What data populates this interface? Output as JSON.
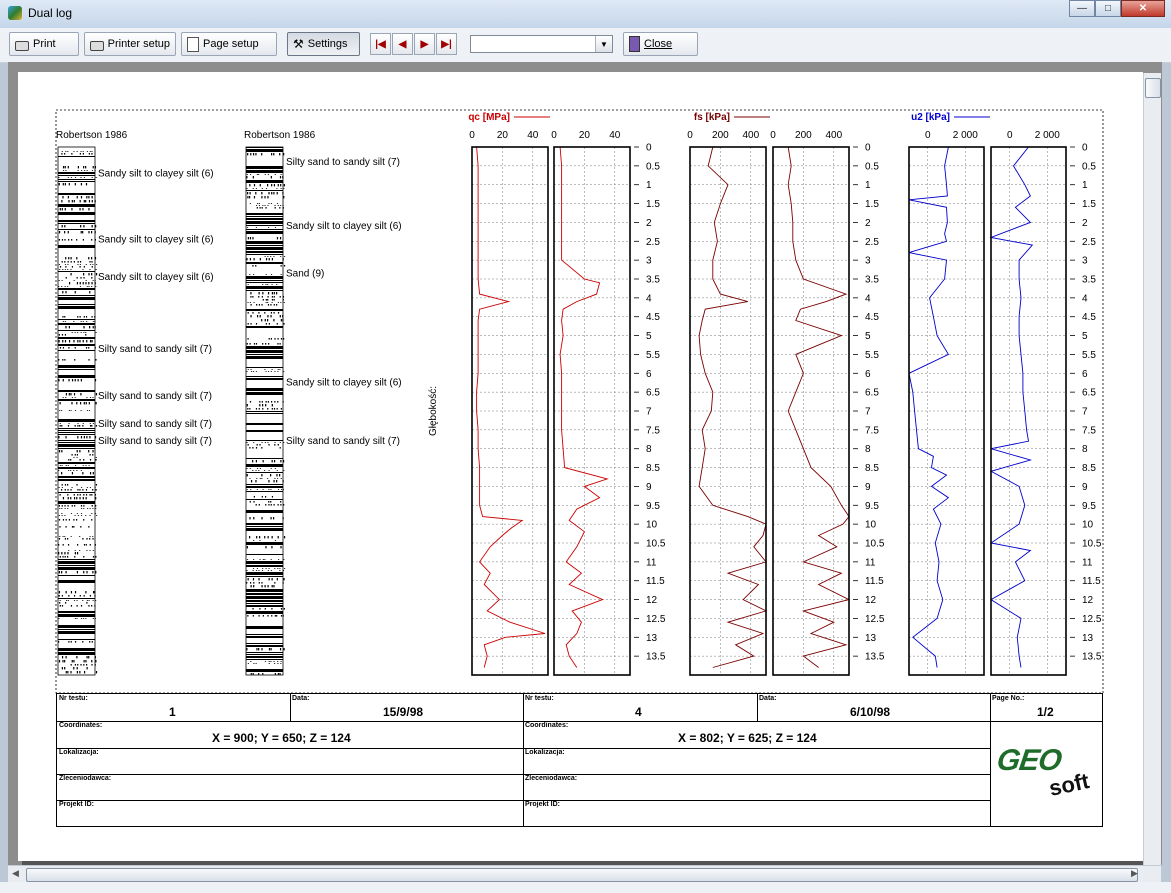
{
  "window": {
    "title": "Dual log"
  },
  "toolbar": {
    "print_label": "Print",
    "printer_setup_label": "Printer setup",
    "page_setup_label": "Page setup",
    "settings_label": "Settings",
    "close_label": "Close",
    "combo_value": "",
    "nav": {
      "first": "|◀",
      "prev": "◀",
      "next": "▶",
      "last": "▶|"
    }
  },
  "columns": {
    "left": {
      "title": "Robertson 1986",
      "labels": [
        {
          "depth": 0.7,
          "text": "Sandy silt to clayey silt (6)"
        },
        {
          "depth": 2.45,
          "text": "Sandy silt to clayey silt (6)"
        },
        {
          "depth": 3.45,
          "text": "Sandy silt to clayey silt (6)"
        },
        {
          "depth": 5.35,
          "text": "Silty sand to sandy silt (7)"
        },
        {
          "depth": 6.6,
          "text": "Silty sand to sandy silt (7)"
        },
        {
          "depth": 7.35,
          "text": "Silty sand to sandy silt (7)"
        },
        {
          "depth": 7.8,
          "text": "Silty sand to sandy silt (7)"
        }
      ]
    },
    "right": {
      "title": "Robertson 1986",
      "labels": [
        {
          "depth": 0.4,
          "text": "Silty sand to sandy silt (7)"
        },
        {
          "depth": 2.1,
          "text": "Sandy silt to clayey silt (6)"
        },
        {
          "depth": 3.35,
          "text": "Sand (9)"
        },
        {
          "depth": 6.25,
          "text": "Sandy silt to clayey silt (6)"
        },
        {
          "depth": 7.8,
          "text": "Silty sand to sandy silt (7)"
        }
      ]
    }
  },
  "chart_data": {
    "type": "line",
    "ylabel": "Głębokość:",
    "ylim": [
      0,
      14
    ],
    "y_ticks": [
      "0",
      "0.5",
      "1",
      "1.5",
      "2",
      "2.5",
      "3",
      "3.5",
      "4",
      "4.5",
      "5",
      "5.5",
      "6",
      "6.5",
      "7",
      "7.5",
      "8",
      "8.5",
      "9",
      "9.5",
      "10",
      "10.5",
      "11",
      "11.5",
      "12",
      "12.5",
      "13",
      "13.5"
    ],
    "grid": true,
    "panels": [
      {
        "name": "qc [MPa]",
        "color": "#cc0000",
        "xlim": [
          0,
          50
        ],
        "ticks": [
          "0",
          "20",
          "40"
        ],
        "series": [
          {
            "depth": [
              0,
              0.5,
              1,
              1.5,
              2,
              2.5,
              3,
              3.5,
              3.9,
              4.1,
              4.3,
              4.6,
              5,
              5.5,
              6,
              6.5,
              7,
              7.5,
              8,
              8.5,
              9,
              9.5,
              9.8,
              9.9,
              10.1,
              10.3,
              10.6,
              11,
              11.3,
              11.6,
              12,
              12.3,
              12.6,
              12.9,
              13.0,
              13.2,
              13.5,
              13.8
            ],
            "value": [
              3,
              4,
              4,
              4,
              4,
              4,
              4,
              4,
              5,
              24,
              5,
              4,
              4,
              4,
              4,
              3,
              3,
              4,
              4,
              5,
              5,
              5,
              7,
              33,
              26,
              20,
              12,
              5,
              12,
              8,
              18,
              10,
              25,
              48,
              22,
              8,
              10,
              8
            ]
          },
          {
            "depth": [
              0,
              0.5,
              1,
              1.5,
              2,
              2.5,
              3,
              3.5,
              3.6,
              3.9,
              4.1,
              4.3,
              4.6,
              5,
              5.5,
              6,
              6.5,
              7,
              7.5,
              8,
              8.5,
              8.8,
              9,
              9.3,
              9.6,
              9.9,
              10.2,
              10.6,
              11,
              11.3,
              11.6,
              12,
              12.3,
              12.6,
              12.9,
              13.2,
              13.5,
              13.8
            ],
            "value": [
              4,
              5,
              5,
              5,
              5,
              5,
              5,
              20,
              30,
              28,
              15,
              6,
              5,
              6,
              4,
              5,
              5,
              5,
              5,
              6,
              7,
              35,
              20,
              30,
              15,
              10,
              20,
              15,
              8,
              18,
              10,
              32,
              12,
              18,
              15,
              8,
              10,
              15
            ]
          }
        ]
      },
      {
        "name": "fs [kPa]",
        "color": "#7a0000",
        "xlim": [
          0,
          500
        ],
        "ticks": [
          "0",
          "200",
          "400"
        ],
        "series": [
          {
            "depth": [
              0,
              0.5,
              1,
              1.5,
              2,
              2.5,
              3,
              3.5,
              3.9,
              4.1,
              4.3,
              4.6,
              5,
              5.5,
              6,
              6.5,
              7,
              7.5,
              8,
              8.5,
              9,
              9.5,
              9.8,
              10,
              10.3,
              10.6,
              11,
              11.3,
              11.6,
              12,
              12.3,
              12.6,
              12.9,
              13.2,
              13.5,
              13.8
            ],
            "value": [
              150,
              120,
              250,
              200,
              160,
              180,
              150,
              150,
              200,
              380,
              100,
              80,
              60,
              70,
              100,
              150,
              140,
              80,
              100,
              80,
              60,
              150,
              380,
              500,
              480,
              420,
              500,
              250,
              450,
              350,
              500,
              250,
              480,
              300,
              420,
              150
            ]
          },
          {
            "depth": [
              0,
              0.5,
              1,
              1.5,
              2,
              2.5,
              3,
              3.5,
              3.9,
              4.1,
              4.3,
              4.6,
              5,
              5.5,
              6,
              6.5,
              7,
              7.5,
              8,
              8.5,
              9,
              9.5,
              9.8,
              10,
              10.3,
              10.6,
              11,
              11.3,
              11.6,
              12,
              12.3,
              12.6,
              12.9,
              13.2,
              13.5,
              13.8
            ],
            "value": [
              100,
              120,
              100,
              120,
              130,
              130,
              150,
              200,
              480,
              350,
              180,
              150,
              450,
              150,
              200,
              150,
              100,
              150,
              200,
              250,
              380,
              450,
              500,
              460,
              300,
              420,
              200,
              450,
              300,
              500,
              200,
              400,
              250,
              480,
              200,
              300
            ]
          }
        ]
      },
      {
        "name": "u2 [kPa]",
        "color": "#0000cc",
        "xlim": [
          -1000,
          3000
        ],
        "ticks": [
          "0",
          "2 000"
        ],
        "series": [
          {
            "depth": [
              0,
              0.5,
              1,
              1.3,
              1.4,
              1.6,
              2,
              2.3,
              2.5,
              2.8,
              3,
              3.5,
              4,
              4.5,
              5,
              5.5,
              6,
              6.5,
              7,
              7.5,
              8,
              8.2,
              8.5,
              8.7,
              9,
              9.3,
              9.6,
              10,
              10.5,
              11,
              11.5,
              12,
              12.5,
              13,
              13.5,
              13.8
            ],
            "value": [
              1100,
              900,
              1000,
              1050,
              -1000,
              1000,
              1050,
              900,
              1000,
              -1000,
              1000,
              900,
              100,
              300,
              500,
              1100,
              -1000,
              -800,
              -700,
              -600,
              -500,
              300,
              200,
              1000,
              200,
              1100,
              300,
              700,
              400,
              600,
              500,
              800,
              500,
              -800,
              400,
              500
            ]
          },
          {
            "depth": [
              0,
              0.5,
              1,
              1.3,
              1.6,
              2,
              2.4,
              2.6,
              3,
              3.5,
              4,
              4.5,
              5,
              5.5,
              6,
              6.5,
              7,
              7.5,
              7.8,
              8.0,
              8.3,
              8.6,
              9,
              9.5,
              10,
              10.5,
              10.7,
              11,
              11.5,
              12,
              12.5,
              13,
              13.5,
              13.8
            ],
            "value": [
              1000,
              200,
              800,
              1100,
              300,
              1100,
              -1000,
              1200,
              500,
              500,
              600,
              500,
              500,
              600,
              700,
              700,
              800,
              900,
              1000,
              -1000,
              1100,
              -1000,
              500,
              800,
              500,
              -1000,
              1100,
              300,
              800,
              -1000,
              600,
              400,
              500,
              600
            ]
          }
        ]
      }
    ]
  },
  "info": {
    "left": {
      "nr_testu_label": "Nr testu:",
      "nr_testu": "1",
      "data_label": "Data:",
      "data": "15/9/98",
      "coordinates_label": "Coordinates:",
      "coordinates": "X = 900; Y = 650; Z = 124",
      "lokalizacja_label": "Lokalizacja:",
      "zleceniodawca_label": "Zleceniodawca:",
      "projekt_label": "Projekt ID:"
    },
    "right": {
      "nr_testu_label": "Nr testu:",
      "nr_testu": "4",
      "data_label": "Data:",
      "data": "6/10/98",
      "coordinates_label": "Coordinates:",
      "coordinates": "X = 802; Y = 625; Z = 124",
      "lokalizacja_label": "Lokalizacja:",
      "zleceniodawca_label": "Zleceniodawca:",
      "projekt_label": "Projekt ID:"
    },
    "page_no_label": "Page No.:",
    "page_no": "1/2",
    "logo_text_1": "GEO",
    "logo_text_2": "soft"
  }
}
